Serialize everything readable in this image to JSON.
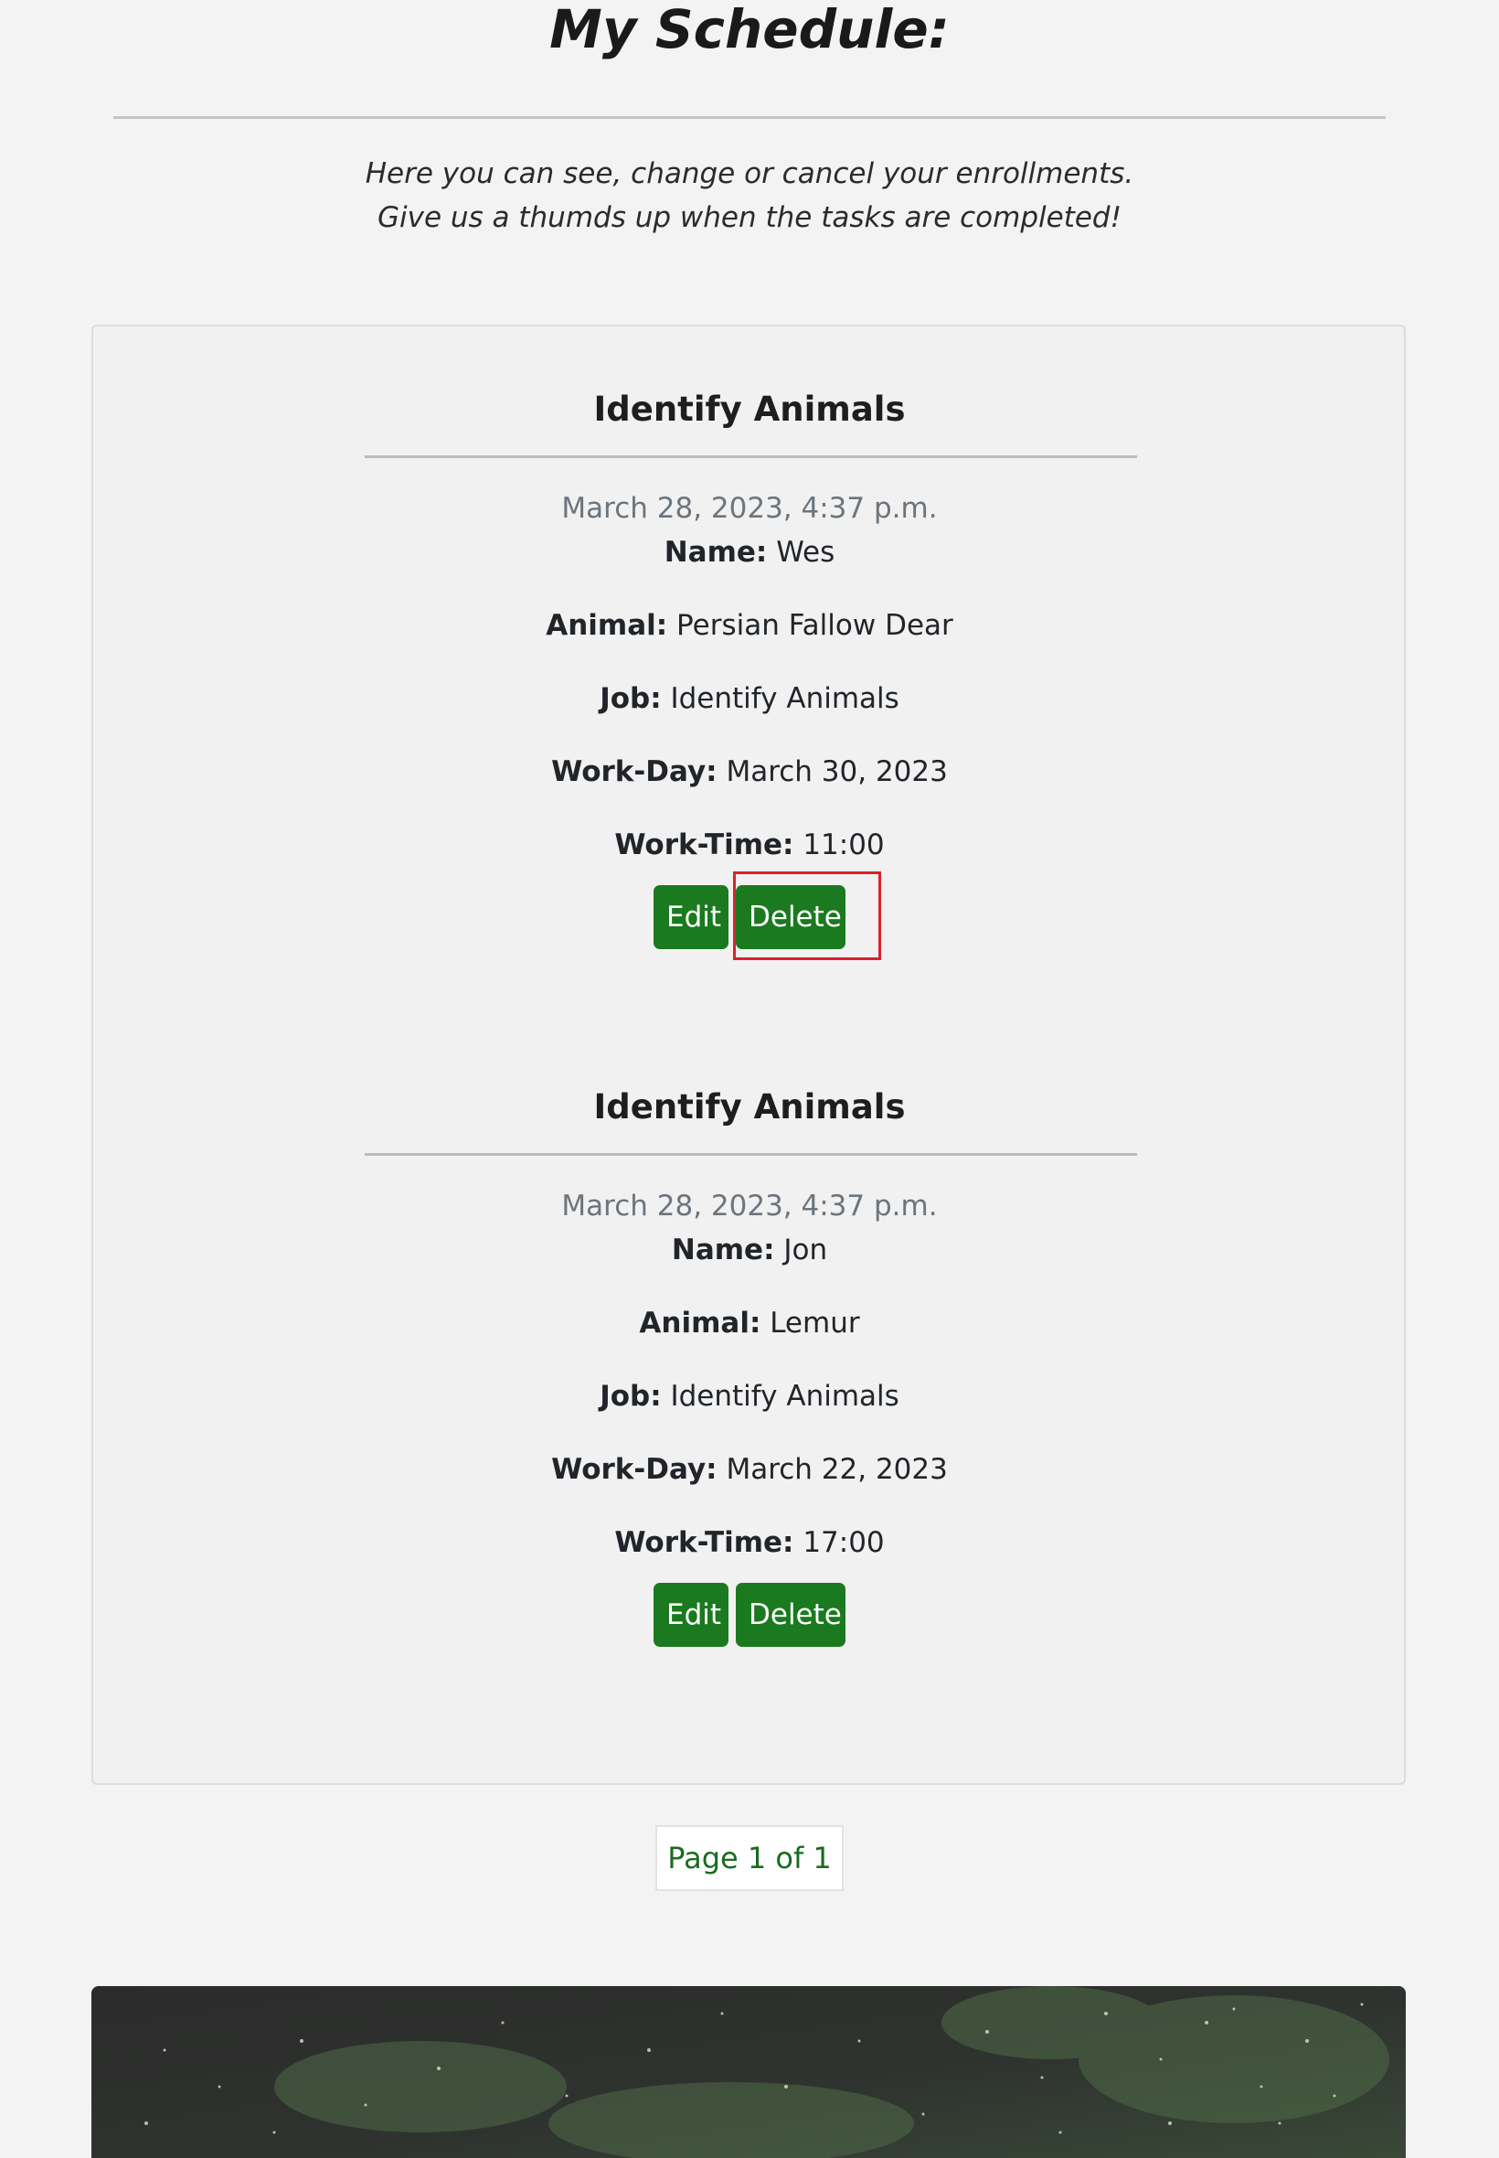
{
  "header": {
    "title": "My Schedule:",
    "intro_line_1": "Here you can see, change or cancel your enrollments.",
    "intro_line_2": "Give us a thumds up when the tasks are completed!"
  },
  "enrollments": [
    {
      "title": "Identify Animals",
      "date": "March 28, 2023, 4:37 p.m.",
      "name_label": "Name:",
      "name": "Wes",
      "animal_label": "Animal:",
      "animal": "Persian Fallow Dear",
      "job_label": "Job:",
      "job": "Identify Animals",
      "workday_label": "Work-Day:",
      "workday": "March 30, 2023",
      "worktime_label": "Work-Time:",
      "worktime": "11:00",
      "edit_label": "Edit",
      "delete_label": "Delete"
    },
    {
      "title": "Identify Animals",
      "date": "March 28, 2023, 4:37 p.m.",
      "name_label": "Name:",
      "name": "Jon",
      "animal_label": "Animal:",
      "animal": "Lemur",
      "job_label": "Job:",
      "job": "Identify Animals",
      "workday_label": "Work-Day:",
      "workday": "March 22, 2023",
      "worktime_label": "Work-Time:",
      "worktime": "17:00",
      "edit_label": "Edit",
      "delete_label": "Delete"
    }
  ],
  "pagination": {
    "label": "Page 1 of 1"
  },
  "colors": {
    "button": "#1b7a1f",
    "highlight": "#d9232a",
    "pagination_text": "#1a6b1f"
  }
}
